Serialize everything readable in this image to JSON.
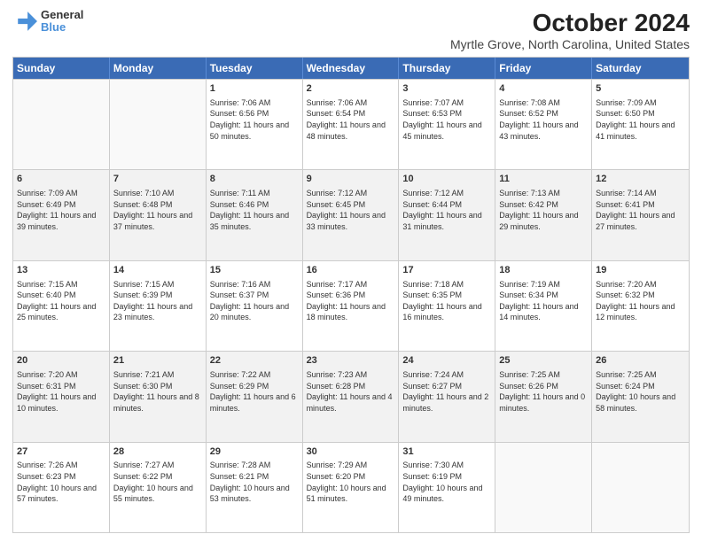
{
  "header": {
    "logo_line1": "General",
    "logo_line2": "Blue",
    "title": "October 2024",
    "subtitle": "Myrtle Grove, North Carolina, United States"
  },
  "days_of_week": [
    "Sunday",
    "Monday",
    "Tuesday",
    "Wednesday",
    "Thursday",
    "Friday",
    "Saturday"
  ],
  "weeks": [
    [
      {
        "day": "",
        "empty": true
      },
      {
        "day": "",
        "empty": true
      },
      {
        "day": "1",
        "sunrise": "Sunrise: 7:06 AM",
        "sunset": "Sunset: 6:56 PM",
        "daylight": "Daylight: 11 hours and 50 minutes."
      },
      {
        "day": "2",
        "sunrise": "Sunrise: 7:06 AM",
        "sunset": "Sunset: 6:54 PM",
        "daylight": "Daylight: 11 hours and 48 minutes."
      },
      {
        "day": "3",
        "sunrise": "Sunrise: 7:07 AM",
        "sunset": "Sunset: 6:53 PM",
        "daylight": "Daylight: 11 hours and 45 minutes."
      },
      {
        "day": "4",
        "sunrise": "Sunrise: 7:08 AM",
        "sunset": "Sunset: 6:52 PM",
        "daylight": "Daylight: 11 hours and 43 minutes."
      },
      {
        "day": "5",
        "sunrise": "Sunrise: 7:09 AM",
        "sunset": "Sunset: 6:50 PM",
        "daylight": "Daylight: 11 hours and 41 minutes."
      }
    ],
    [
      {
        "day": "6",
        "sunrise": "Sunrise: 7:09 AM",
        "sunset": "Sunset: 6:49 PM",
        "daylight": "Daylight: 11 hours and 39 minutes."
      },
      {
        "day": "7",
        "sunrise": "Sunrise: 7:10 AM",
        "sunset": "Sunset: 6:48 PM",
        "daylight": "Daylight: 11 hours and 37 minutes."
      },
      {
        "day": "8",
        "sunrise": "Sunrise: 7:11 AM",
        "sunset": "Sunset: 6:46 PM",
        "daylight": "Daylight: 11 hours and 35 minutes."
      },
      {
        "day": "9",
        "sunrise": "Sunrise: 7:12 AM",
        "sunset": "Sunset: 6:45 PM",
        "daylight": "Daylight: 11 hours and 33 minutes."
      },
      {
        "day": "10",
        "sunrise": "Sunrise: 7:12 AM",
        "sunset": "Sunset: 6:44 PM",
        "daylight": "Daylight: 11 hours and 31 minutes."
      },
      {
        "day": "11",
        "sunrise": "Sunrise: 7:13 AM",
        "sunset": "Sunset: 6:42 PM",
        "daylight": "Daylight: 11 hours and 29 minutes."
      },
      {
        "day": "12",
        "sunrise": "Sunrise: 7:14 AM",
        "sunset": "Sunset: 6:41 PM",
        "daylight": "Daylight: 11 hours and 27 minutes."
      }
    ],
    [
      {
        "day": "13",
        "sunrise": "Sunrise: 7:15 AM",
        "sunset": "Sunset: 6:40 PM",
        "daylight": "Daylight: 11 hours and 25 minutes."
      },
      {
        "day": "14",
        "sunrise": "Sunrise: 7:15 AM",
        "sunset": "Sunset: 6:39 PM",
        "daylight": "Daylight: 11 hours and 23 minutes."
      },
      {
        "day": "15",
        "sunrise": "Sunrise: 7:16 AM",
        "sunset": "Sunset: 6:37 PM",
        "daylight": "Daylight: 11 hours and 20 minutes."
      },
      {
        "day": "16",
        "sunrise": "Sunrise: 7:17 AM",
        "sunset": "Sunset: 6:36 PM",
        "daylight": "Daylight: 11 hours and 18 minutes."
      },
      {
        "day": "17",
        "sunrise": "Sunrise: 7:18 AM",
        "sunset": "Sunset: 6:35 PM",
        "daylight": "Daylight: 11 hours and 16 minutes."
      },
      {
        "day": "18",
        "sunrise": "Sunrise: 7:19 AM",
        "sunset": "Sunset: 6:34 PM",
        "daylight": "Daylight: 11 hours and 14 minutes."
      },
      {
        "day": "19",
        "sunrise": "Sunrise: 7:20 AM",
        "sunset": "Sunset: 6:32 PM",
        "daylight": "Daylight: 11 hours and 12 minutes."
      }
    ],
    [
      {
        "day": "20",
        "sunrise": "Sunrise: 7:20 AM",
        "sunset": "Sunset: 6:31 PM",
        "daylight": "Daylight: 11 hours and 10 minutes."
      },
      {
        "day": "21",
        "sunrise": "Sunrise: 7:21 AM",
        "sunset": "Sunset: 6:30 PM",
        "daylight": "Daylight: 11 hours and 8 minutes."
      },
      {
        "day": "22",
        "sunrise": "Sunrise: 7:22 AM",
        "sunset": "Sunset: 6:29 PM",
        "daylight": "Daylight: 11 hours and 6 minutes."
      },
      {
        "day": "23",
        "sunrise": "Sunrise: 7:23 AM",
        "sunset": "Sunset: 6:28 PM",
        "daylight": "Daylight: 11 hours and 4 minutes."
      },
      {
        "day": "24",
        "sunrise": "Sunrise: 7:24 AM",
        "sunset": "Sunset: 6:27 PM",
        "daylight": "Daylight: 11 hours and 2 minutes."
      },
      {
        "day": "25",
        "sunrise": "Sunrise: 7:25 AM",
        "sunset": "Sunset: 6:26 PM",
        "daylight": "Daylight: 11 hours and 0 minutes."
      },
      {
        "day": "26",
        "sunrise": "Sunrise: 7:25 AM",
        "sunset": "Sunset: 6:24 PM",
        "daylight": "Daylight: 10 hours and 58 minutes."
      }
    ],
    [
      {
        "day": "27",
        "sunrise": "Sunrise: 7:26 AM",
        "sunset": "Sunset: 6:23 PM",
        "daylight": "Daylight: 10 hours and 57 minutes."
      },
      {
        "day": "28",
        "sunrise": "Sunrise: 7:27 AM",
        "sunset": "Sunset: 6:22 PM",
        "daylight": "Daylight: 10 hours and 55 minutes."
      },
      {
        "day": "29",
        "sunrise": "Sunrise: 7:28 AM",
        "sunset": "Sunset: 6:21 PM",
        "daylight": "Daylight: 10 hours and 53 minutes."
      },
      {
        "day": "30",
        "sunrise": "Sunrise: 7:29 AM",
        "sunset": "Sunset: 6:20 PM",
        "daylight": "Daylight: 10 hours and 51 minutes."
      },
      {
        "day": "31",
        "sunrise": "Sunrise: 7:30 AM",
        "sunset": "Sunset: 6:19 PM",
        "daylight": "Daylight: 10 hours and 49 minutes."
      },
      {
        "day": "",
        "empty": true
      },
      {
        "day": "",
        "empty": true
      }
    ]
  ]
}
